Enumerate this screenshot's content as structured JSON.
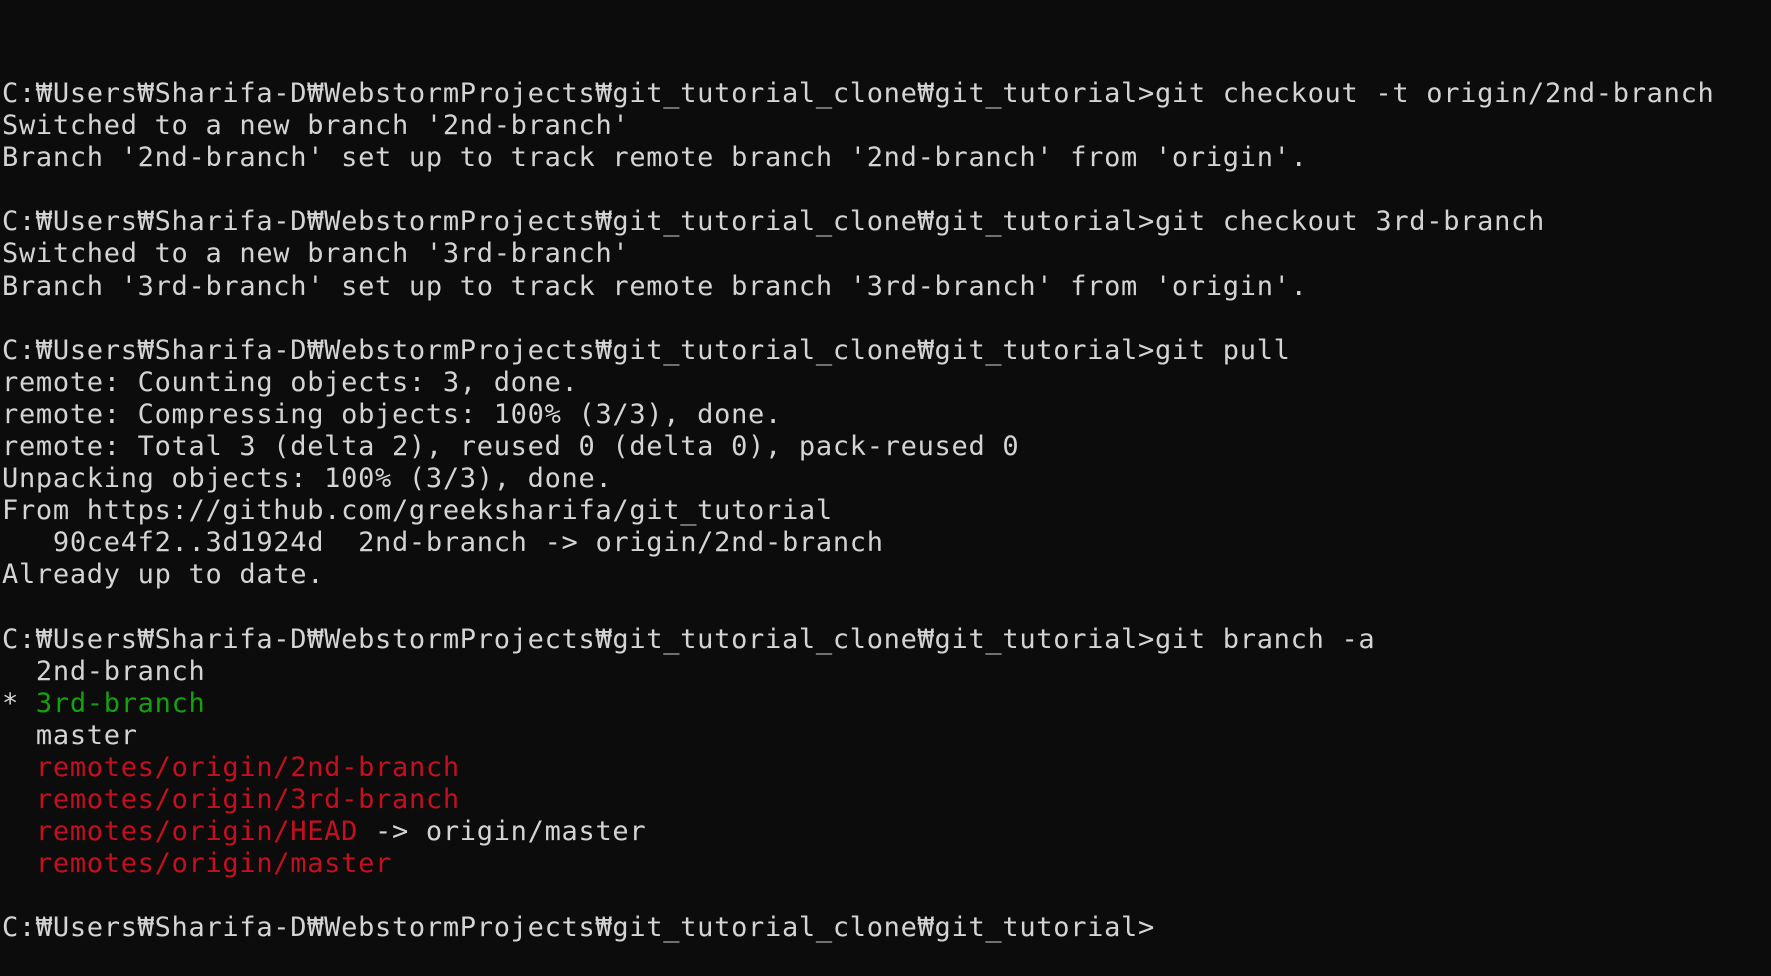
{
  "terminal": {
    "colors": {
      "background": "#0c0c0c",
      "default": "#d4d4d4",
      "green": "#13a10e",
      "red": "#c50f1f"
    },
    "lines": [
      {
        "kind": "command",
        "segments": [
          {
            "text": "C:₩Users₩Sharifa-D₩WebstormProjects₩git_tutorial_clone₩git_tutorial>git checkout -t origin/2nd-branch",
            "color": "default"
          }
        ]
      },
      {
        "kind": "output",
        "segments": [
          {
            "text": "Switched to a new branch '2nd-branch'",
            "color": "default"
          }
        ]
      },
      {
        "kind": "output",
        "segments": [
          {
            "text": "Branch '2nd-branch' set up to track remote branch '2nd-branch' from 'origin'.",
            "color": "default"
          }
        ]
      },
      {
        "kind": "blank",
        "segments": [
          {
            "text": "",
            "color": "default"
          }
        ]
      },
      {
        "kind": "command",
        "segments": [
          {
            "text": "C:₩Users₩Sharifa-D₩WebstormProjects₩git_tutorial_clone₩git_tutorial>git checkout 3rd-branch",
            "color": "default"
          }
        ]
      },
      {
        "kind": "output",
        "segments": [
          {
            "text": "Switched to a new branch '3rd-branch'",
            "color": "default"
          }
        ]
      },
      {
        "kind": "output",
        "segments": [
          {
            "text": "Branch '3rd-branch' set up to track remote branch '3rd-branch' from 'origin'.",
            "color": "default"
          }
        ]
      },
      {
        "kind": "blank",
        "segments": [
          {
            "text": "",
            "color": "default"
          }
        ]
      },
      {
        "kind": "command",
        "segments": [
          {
            "text": "C:₩Users₩Sharifa-D₩WebstormProjects₩git_tutorial_clone₩git_tutorial>git pull",
            "color": "default"
          }
        ]
      },
      {
        "kind": "output",
        "segments": [
          {
            "text": "remote: Counting objects: 3, done.",
            "color": "default"
          }
        ]
      },
      {
        "kind": "output",
        "segments": [
          {
            "text": "remote: Compressing objects: 100% (3/3), done.",
            "color": "default"
          }
        ]
      },
      {
        "kind": "output",
        "segments": [
          {
            "text": "remote: Total 3 (delta 2), reused 0 (delta 0), pack-reused 0",
            "color": "default"
          }
        ]
      },
      {
        "kind": "output",
        "segments": [
          {
            "text": "Unpacking objects: 100% (3/3), done.",
            "color": "default"
          }
        ]
      },
      {
        "kind": "output",
        "segments": [
          {
            "text": "From https://github.com/greeksharifa/git_tutorial",
            "color": "default"
          }
        ]
      },
      {
        "kind": "output",
        "segments": [
          {
            "text": "   90ce4f2..3d1924d  2nd-branch -> origin/2nd-branch",
            "color": "default"
          }
        ]
      },
      {
        "kind": "output",
        "segments": [
          {
            "text": "Already up to date.",
            "color": "default"
          }
        ]
      },
      {
        "kind": "blank",
        "segments": [
          {
            "text": "",
            "color": "default"
          }
        ]
      },
      {
        "kind": "command",
        "segments": [
          {
            "text": "C:₩Users₩Sharifa-D₩WebstormProjects₩git_tutorial_clone₩git_tutorial>git branch -a",
            "color": "default"
          }
        ]
      },
      {
        "kind": "branch",
        "segments": [
          {
            "text": "  2nd-branch",
            "color": "default"
          }
        ]
      },
      {
        "kind": "branch",
        "segments": [
          {
            "text": "* ",
            "color": "default"
          },
          {
            "text": "3rd-branch",
            "color": "green"
          }
        ]
      },
      {
        "kind": "branch",
        "segments": [
          {
            "text": "  master",
            "color": "default"
          }
        ]
      },
      {
        "kind": "branch",
        "segments": [
          {
            "text": "  ",
            "color": "default"
          },
          {
            "text": "remotes/origin/2nd-branch",
            "color": "red"
          }
        ]
      },
      {
        "kind": "branch",
        "segments": [
          {
            "text": "  ",
            "color": "default"
          },
          {
            "text": "remotes/origin/3rd-branch",
            "color": "red"
          }
        ]
      },
      {
        "kind": "branch",
        "segments": [
          {
            "text": "  ",
            "color": "default"
          },
          {
            "text": "remotes/origin/HEAD",
            "color": "red"
          },
          {
            "text": " -> origin/master",
            "color": "default"
          }
        ]
      },
      {
        "kind": "branch",
        "segments": [
          {
            "text": "  ",
            "color": "default"
          },
          {
            "text": "remotes/origin/master",
            "color": "red"
          }
        ]
      },
      {
        "kind": "blank",
        "segments": [
          {
            "text": "",
            "color": "default"
          }
        ]
      },
      {
        "kind": "prompt",
        "segments": [
          {
            "text": "C:₩Users₩Sharifa-D₩WebstormProjects₩git_tutorial_clone₩git_tutorial>",
            "color": "default"
          }
        ]
      }
    ]
  }
}
